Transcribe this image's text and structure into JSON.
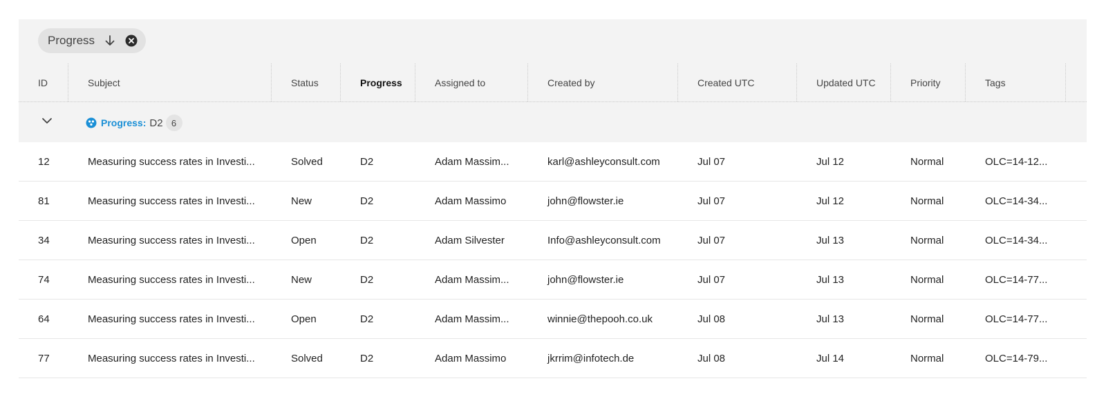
{
  "toolbar": {
    "sort_chip_label": "Progress",
    "sort_direction_icon": "arrow-down-icon",
    "remove_icon": "close-circle-icon"
  },
  "columns": [
    "ID",
    "Subject",
    "Status",
    "Progress",
    "Assigned to",
    "Created by",
    "Created UTC",
    "Updated UTC",
    "Priority",
    "Tags"
  ],
  "group": {
    "field_label": "Progress:",
    "value": "D2",
    "count": "6",
    "accent_color": "#1a8fd6"
  },
  "rows": [
    {
      "id": "12",
      "subject": "Measuring success rates in Investi...",
      "status": "Solved",
      "progress": "D2",
      "assigned": "Adam Massim...",
      "created_by": "karl@ashleyconsult.com",
      "created_utc": "Jul 07",
      "updated_utc": "Jul 12",
      "priority": "Normal",
      "tags": "OLC=14-12..."
    },
    {
      "id": "81",
      "subject": "Measuring success rates in Investi...",
      "status": "New",
      "progress": "D2",
      "assigned": "Adam Massimo",
      "created_by": "john@flowster.ie",
      "created_utc": "Jul 07",
      "updated_utc": "Jul 12",
      "priority": "Normal",
      "tags": "OLC=14-34..."
    },
    {
      "id": "34",
      "subject": "Measuring success rates in Investi...",
      "status": "Open",
      "progress": "D2",
      "assigned": "Adam Silvester",
      "created_by": "Info@ashleyconsult.com",
      "created_utc": "Jul 07",
      "updated_utc": "Jul 13",
      "priority": "Normal",
      "tags": "OLC=14-34..."
    },
    {
      "id": "74",
      "subject": "Measuring success rates in Investi...",
      "status": "New",
      "progress": "D2",
      "assigned": "Adam Massim...",
      "created_by": "john@flowster.ie",
      "created_utc": "Jul 07",
      "updated_utc": "Jul 13",
      "priority": "Normal",
      "tags": "OLC=14-77..."
    },
    {
      "id": "64",
      "subject": "Measuring success rates in Investi...",
      "status": "Open",
      "progress": "D2",
      "assigned": "Adam Massim...",
      "created_by": "winnie@thepooh.co.uk",
      "created_utc": "Jul 08",
      "updated_utc": "Jul 13",
      "priority": "Normal",
      "tags": "OLC=14-77..."
    },
    {
      "id": "77",
      "subject": "Measuring success rates in Investi...",
      "status": "Solved",
      "progress": "D2",
      "assigned": "Adam Massimo",
      "created_by": "jkrrim@infotech.de",
      "created_utc": "Jul 08",
      "updated_utc": "Jul 14",
      "priority": "Normal",
      "tags": "OLC=14-79..."
    }
  ]
}
